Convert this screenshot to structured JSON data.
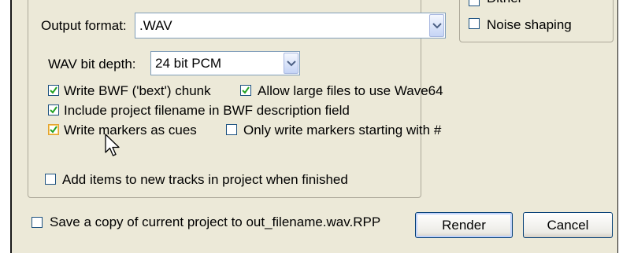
{
  "output_format": {
    "label": "Output format:",
    "value": ".WAV"
  },
  "side_options": {
    "partial_label": "Dither",
    "noise_shaping": "Noise shaping"
  },
  "wav_bit_depth": {
    "label": "WAV bit depth:",
    "value": "24 bit PCM"
  },
  "options": {
    "write_bwf": "Write BWF ('bext') chunk",
    "allow_large": "Allow large files to use Wave64",
    "include_filename": "Include project filename in BWF description field",
    "write_markers": "Write markers as cues",
    "only_markers": "Only write markers starting with #"
  },
  "add_items": "Add items to new tracks in project when finished",
  "save_copy": "Save a copy of current project to out_filename.wav.RPP",
  "buttons": {
    "render": "Render",
    "cancel": "Cancel"
  },
  "checkbox_states": {
    "write_bwf": true,
    "allow_large": true,
    "include_filename": true,
    "write_markers": true,
    "only_markers": false,
    "noise_shaping": false,
    "add_items": false,
    "save_copy": false
  }
}
